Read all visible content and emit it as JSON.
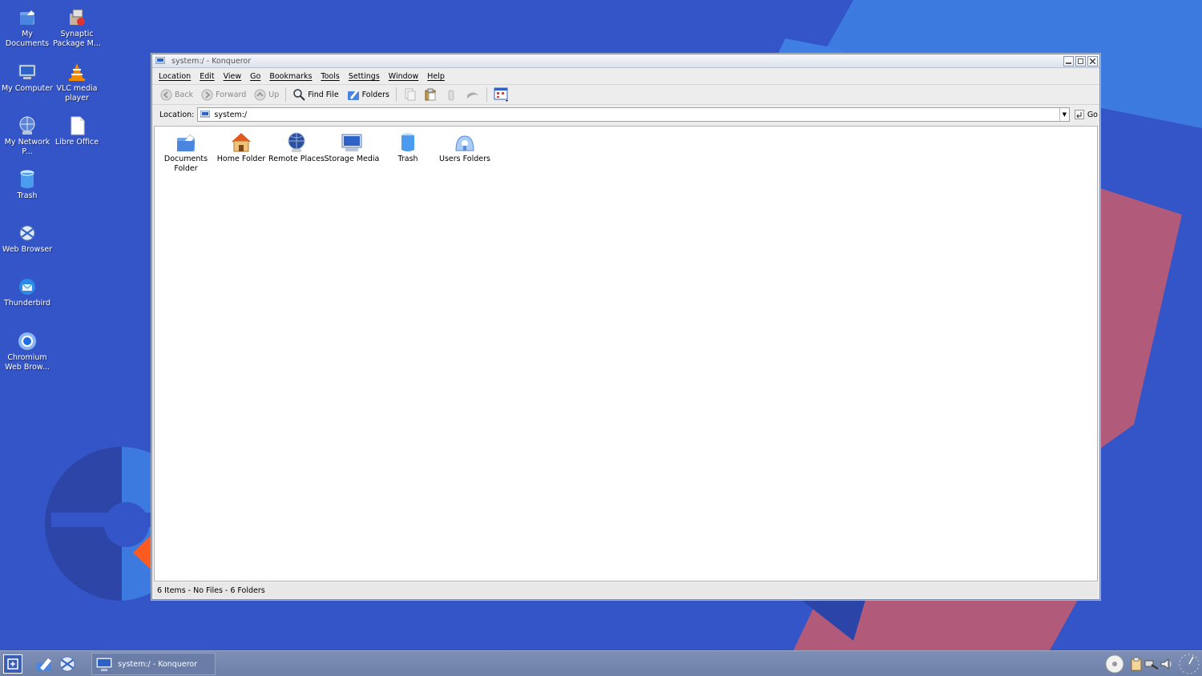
{
  "desktop": {
    "icons": [
      {
        "label": "My Documents",
        "icon": "documents-folder-icon"
      },
      {
        "label": "Synaptic Package M...",
        "icon": "package-icon"
      },
      {
        "label": "My Computer",
        "icon": "computer-icon"
      },
      {
        "label": "VLC media player",
        "icon": "vlc-cone-icon"
      },
      {
        "label": "My Network P...",
        "icon": "network-globe-icon"
      },
      {
        "label": "Libre Office",
        "icon": "document-icon"
      },
      {
        "label": "Trash",
        "icon": "trash-icon"
      },
      {
        "label": "Web Browser",
        "icon": "web-browser-icon"
      },
      {
        "label": "Thunderbird",
        "icon": "thunderbird-icon"
      },
      {
        "label": "Chromium Web Brow...",
        "icon": "chromium-icon"
      }
    ]
  },
  "window": {
    "title": "system:/ - Konqueror",
    "menu": [
      "Location",
      "Edit",
      "View",
      "Go",
      "Bookmarks",
      "Tools",
      "Settings",
      "Window",
      "Help"
    ],
    "toolbar": {
      "back": "Back",
      "forward": "Forward",
      "up": "Up",
      "find_file": "Find File",
      "folders": "Folders"
    },
    "location": {
      "label": "Location:",
      "value": "system:/",
      "go": "Go"
    },
    "items": [
      {
        "label": "Documents Folder",
        "icon": "documents-folder-icon"
      },
      {
        "label": "Home Folder",
        "icon": "home-folder-icon"
      },
      {
        "label": "Remote Places",
        "icon": "remote-places-globe-icon"
      },
      {
        "label": "Storage Media",
        "icon": "storage-media-icon"
      },
      {
        "label": "Trash",
        "icon": "trash-icon"
      },
      {
        "label": "Users Folders",
        "icon": "users-folders-icon"
      }
    ],
    "status": "6 Items - No Files - 6 Folders"
  },
  "taskbar": {
    "task_label": "system:/ - Konqueror"
  },
  "colors": {
    "desktop_blue": "#3455c8",
    "accent_red": "#b25a7a",
    "accent_orange": "#ff5a1f"
  }
}
